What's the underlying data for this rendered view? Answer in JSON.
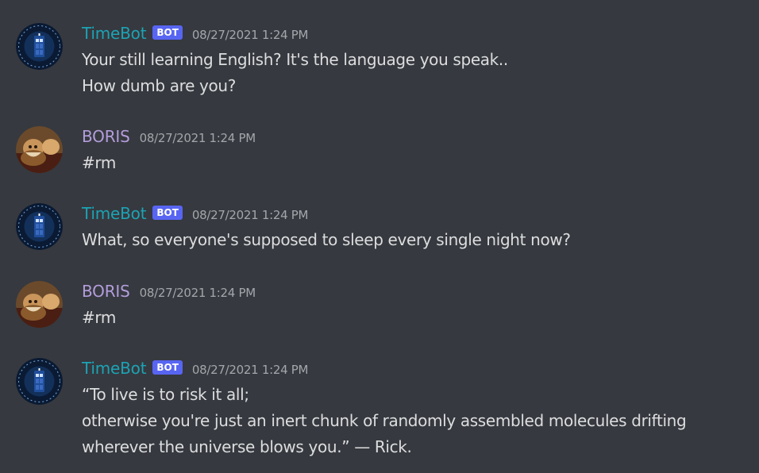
{
  "colors": {
    "background": "#36393f",
    "timebot_name": "#1ca3b4",
    "boris_name": "#b39ddb",
    "bot_badge": "#5865f2",
    "timestamp": "#a3a6aa",
    "message_text": "#dcddde"
  },
  "messages": [
    {
      "author": "TimeBot",
      "badge": "BOT",
      "timestamp": "08/27/2021 1:24 PM",
      "lines": [
        "Your still learning English? It's the language you speak..",
        "How dumb are you?"
      ]
    },
    {
      "author": "BORIS",
      "timestamp": "08/27/2021 1:24 PM",
      "lines": [
        "#rm"
      ]
    },
    {
      "author": "TimeBot",
      "badge": "BOT",
      "timestamp": "08/27/2021 1:24 PM",
      "lines": [
        "What, so everyone's supposed to sleep every single night now?"
      ]
    },
    {
      "author": "BORIS",
      "timestamp": "08/27/2021 1:24 PM",
      "lines": [
        "#rm"
      ]
    },
    {
      "author": "TimeBot",
      "badge": "BOT",
      "timestamp": "08/27/2021 1:24 PM",
      "lines": [
        "“To live is to risk it all;",
        "otherwise you're just an inert chunk of randomly assembled molecules drifting",
        "wherever the universe blows you.” — Rick."
      ]
    }
  ]
}
